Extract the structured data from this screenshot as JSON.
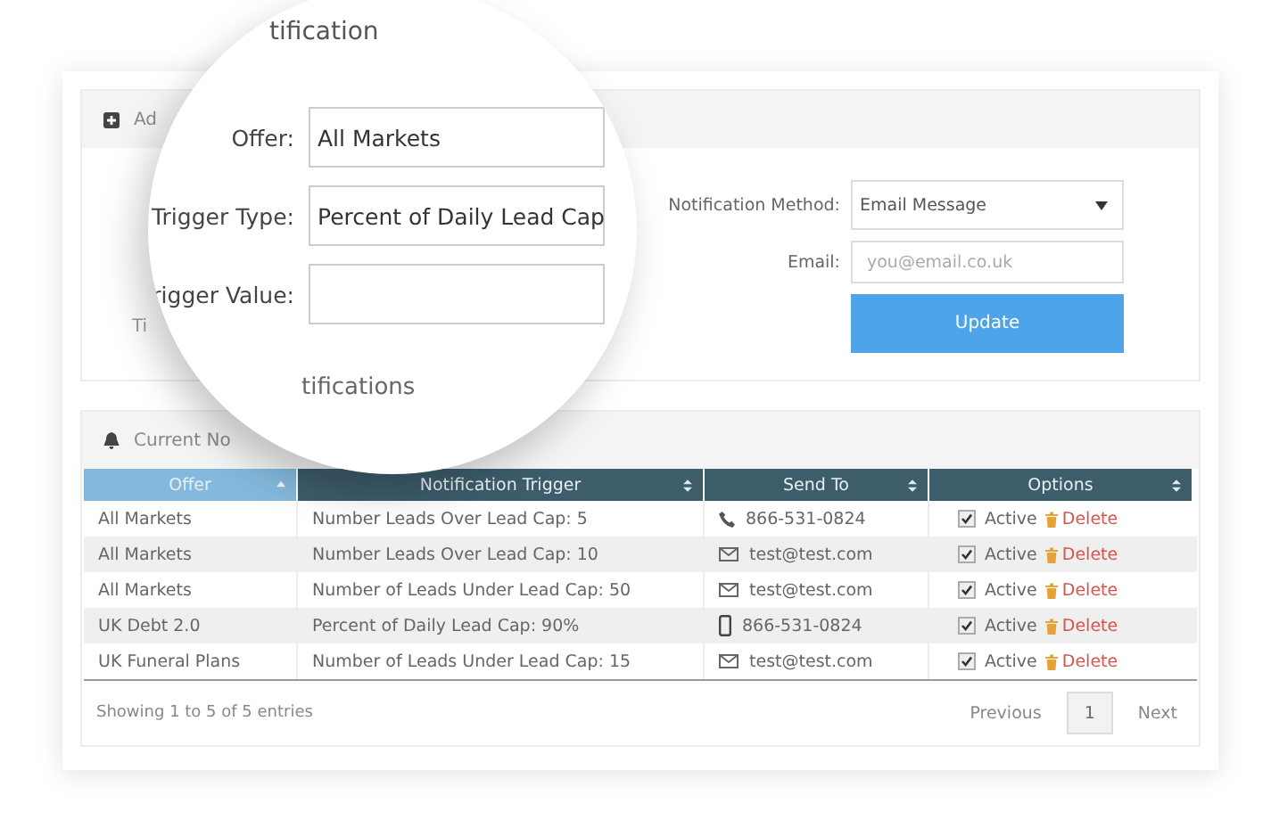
{
  "magnifier": {
    "title": "tification",
    "form": [
      {
        "label": "Offer:",
        "value": "All Markets"
      },
      {
        "label": "Trigger Type:",
        "value": "Percent of Daily Lead Cap"
      },
      {
        "label": "rigger Value:"
      }
    ],
    "section_title": "tifications"
  },
  "add_panel": {
    "header": "Ad",
    "hidden_label": "Ti",
    "notification_method": {
      "label": "Notification Method:",
      "value": "Email Message"
    },
    "email": {
      "label": "Email:",
      "placeholder": "you@email.co.uk"
    },
    "update_button": "Update"
  },
  "notifications_panel": {
    "header": "Current No",
    "table": {
      "columns": [
        {
          "label": "Offer",
          "sorted": true
        },
        {
          "label": "Notification Trigger",
          "sorted": false
        },
        {
          "label": "Send To",
          "sorted": false
        },
        {
          "label": "Options",
          "sorted": false
        }
      ],
      "rows": [
        {
          "offer": "All Markets",
          "trigger": "Number Leads Over Lead Cap: 5",
          "kind": "phone",
          "send_to": "866-531-0824",
          "active": true,
          "active_label": "Active",
          "delete": "Delete"
        },
        {
          "offer": "All Markets",
          "trigger": "Number Leads Over Lead Cap: 10",
          "kind": "email",
          "send_to": "test@test.com",
          "active": true,
          "active_label": "Active",
          "delete": "Delete"
        },
        {
          "offer": "All Markets",
          "trigger": "Number of Leads Under Lead Cap: 50",
          "kind": "email",
          "send_to": "test@test.com",
          "active": true,
          "active_label": "Active",
          "delete": "Delete"
        },
        {
          "offer": "UK Debt 2.0",
          "trigger": "Percent of Daily Lead Cap: 90%",
          "kind": "mobile",
          "send_to": "866-531-0824",
          "active": true,
          "active_label": "Active",
          "delete": "Delete"
        },
        {
          "offer": "UK Funeral Plans",
          "trigger": "Number of Leads Under Lead Cap: 15",
          "kind": "email",
          "send_to": "test@test.com",
          "active": true,
          "active_label": "Active",
          "delete": "Delete"
        }
      ]
    },
    "info": "Showing 1 to 5 of 5 entries",
    "pagination": {
      "previous": "Previous",
      "pages": [
        {
          "label": "1",
          "selected": true
        }
      ],
      "next": "Next"
    }
  }
}
